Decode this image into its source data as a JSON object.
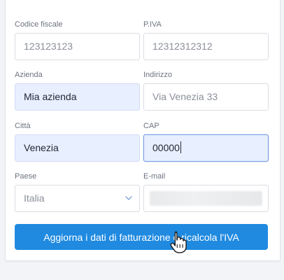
{
  "form": {
    "codice_fiscale": {
      "label": "Codice fiscale",
      "value": "123123123"
    },
    "piva": {
      "label": "P.IVA",
      "value": "12312312312"
    },
    "azienda": {
      "label": "Azienda",
      "value": "Mia azienda"
    },
    "indirizzo": {
      "label": "Indirizzo",
      "value": "Via Venezia 33"
    },
    "citta": {
      "label": "Città",
      "value": "Venezia"
    },
    "cap": {
      "label": "CAP",
      "value": "00000"
    },
    "paese": {
      "label": "Paese",
      "value": "Italia"
    },
    "email": {
      "label": "E-mail"
    }
  },
  "actions": {
    "update_label": "Aggiorna i dati di fatturazione e ricalcola l'IVA"
  },
  "icons": {
    "select_chevron": "chevron-down-icon",
    "cursor": "hand-pointer-icon"
  },
  "colors": {
    "primary_button": "#1f8ae0",
    "filled_field": "#e8efff",
    "focus_border": "#7a9fe0"
  }
}
